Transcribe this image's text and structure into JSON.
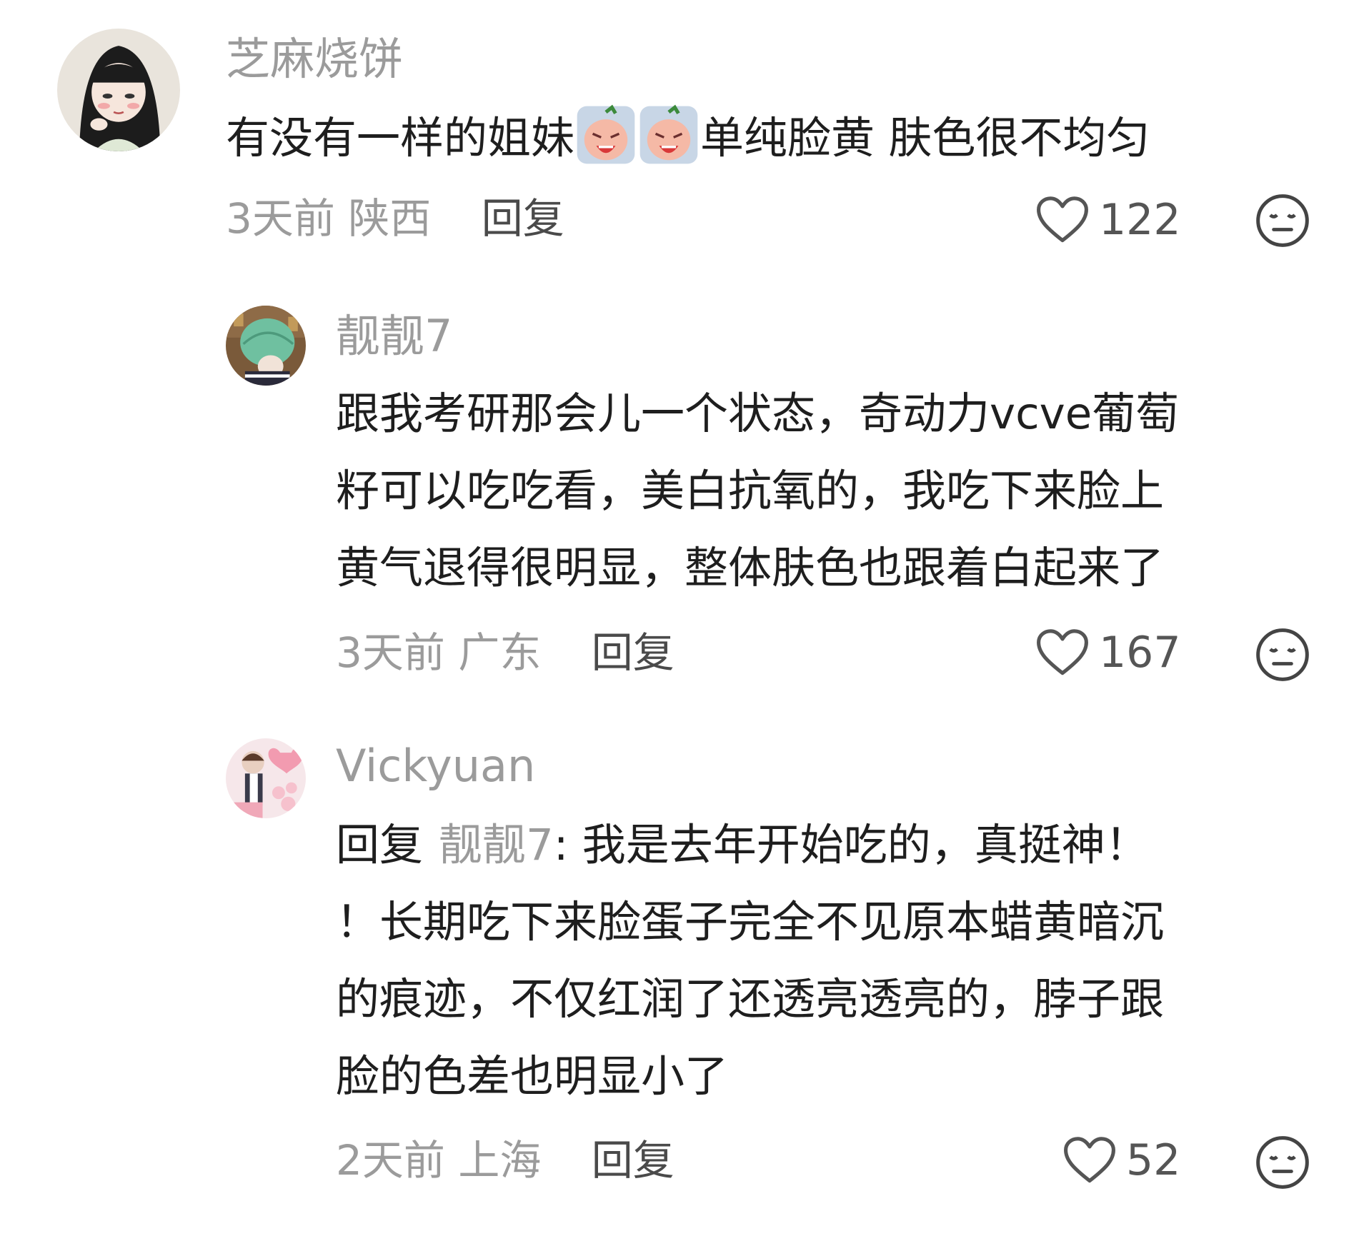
{
  "comments": [
    {
      "username": "芝麻烧饼",
      "text_before": "有没有一样的姐妹",
      "emojis": [
        "crying-face-emoji",
        "crying-face-emoji"
      ],
      "text_after": "单纯脸黄 肤色很不均匀",
      "time": "3天前",
      "location": "陕西",
      "reply_label": "回复",
      "likes": "122"
    },
    {
      "username": "靓靓7",
      "text_lines": [
        "跟我考研那会儿一个状态，奇动力vcve葡萄",
        "籽可以吃吃看，美白抗氧的，我吃下来脸上",
        "黄气退得很明显，整体肤色也跟着白起来了"
      ],
      "time": "3天前",
      "location": "广东",
      "reply_label": "回复",
      "likes": "167"
    },
    {
      "username": "Vickyuan",
      "reply_prefix": "回复",
      "reply_to": "靓靓7",
      "reply_colon": ": ",
      "first_line_text": "我是去年开始吃的，真挺神！",
      "text_lines": [
        "！长期吃下来脸蛋子完全不见原本蜡黄暗沉",
        "的痕迹，不仅红润了还透亮透亮的，脖子跟",
        "脸的色差也明显小了"
      ],
      "time": "2天前",
      "location": "上海",
      "reply_label": "回复",
      "likes": "52"
    }
  ],
  "icons": {
    "like": "heart-outline-icon",
    "dislike": "meh-face-icon"
  },
  "colors": {
    "secondary_text": "#9b9b9b",
    "primary_text": "#1e1e1e"
  }
}
